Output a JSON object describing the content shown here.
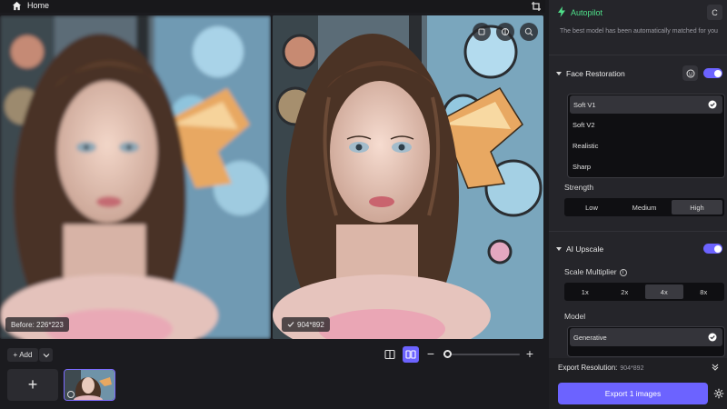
{
  "topbar": {
    "home_label": "Home"
  },
  "preview": {
    "before_label": "Before: 226*223",
    "after_label": "904*892",
    "tools": [
      "eraser-icon",
      "compare-icon",
      "zoom-icon"
    ]
  },
  "bottombar": {
    "add_label": "Add",
    "add_tile_label": "+",
    "zoom_minus": "−",
    "zoom_plus": "+",
    "zoom_level": 0.05
  },
  "panel": {
    "autopilot": {
      "title": "Autopilot",
      "refresh_label": "C",
      "description": "The best model has been automatically matched for you"
    },
    "face_restoration": {
      "title": "Face Restoration",
      "enabled": true,
      "models": [
        "Soft V1",
        "Soft V2",
        "Realistic",
        "Sharp"
      ],
      "selected_model": "Soft V1",
      "strength_label": "Strength",
      "strength_options": [
        "Low",
        "Medium",
        "High"
      ],
      "strength_selected": "High"
    },
    "ai_upscale": {
      "title": "AI Upscale",
      "enabled": true,
      "scale_label": "Scale Multiplier",
      "scale_options": [
        "1x",
        "2x",
        "4x",
        "8x"
      ],
      "scale_selected": "4x",
      "model_label": "Model",
      "models_visible": [
        "Generative"
      ],
      "selected_model": "Generative"
    },
    "export": {
      "resolution_label": "Export Resolution:",
      "resolution_value": "904*892",
      "button_label": "Export 1 images"
    }
  },
  "colors": {
    "accent": "#6c63ff",
    "autopilot_green": "#4fe08a",
    "panel_bg": "#25252a",
    "app_bg": "#1b1b1f"
  }
}
